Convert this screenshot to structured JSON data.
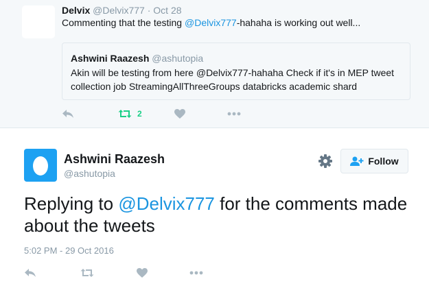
{
  "context_tweet": {
    "author_name": "Delvix",
    "author_handle": "@Delvix777",
    "separator": "·",
    "date": "Oct 28",
    "text_prefix": "Commenting that the testing ",
    "mention": "@Delvix777",
    "text_suffix": "-hahaha is working out well...",
    "quoted": {
      "author_name": "Ashwini Raazesh",
      "author_handle": "@ashutopia",
      "text": "Akin will be testing from here @Delvix777-hahaha Check if it's in MEP tweet collection job StreamingAllThreeGroups databricks academic shard"
    },
    "retweet_count": "2",
    "icons": [
      "reply-icon",
      "retweet-icon",
      "like-icon",
      "more-icon"
    ]
  },
  "main_tweet": {
    "author_name": "Ashwini Raazesh",
    "author_handle": "@ashutopia",
    "follow_label": "Follow",
    "text_prefix": "Replying to ",
    "mention": "@Delvix777",
    "text_suffix": " for the comments made about the tweets",
    "timestamp": "5:02 PM - 29 Oct 2016",
    "icons": [
      "reply-icon",
      "retweet-icon",
      "like-icon",
      "more-icon"
    ]
  },
  "colors": {
    "accent": "#1b95e0",
    "retweet_active": "#19cf86",
    "muted": "#8899a6",
    "avatar_blue": "#1da1f2",
    "context_bg": "#f5f8fa"
  }
}
